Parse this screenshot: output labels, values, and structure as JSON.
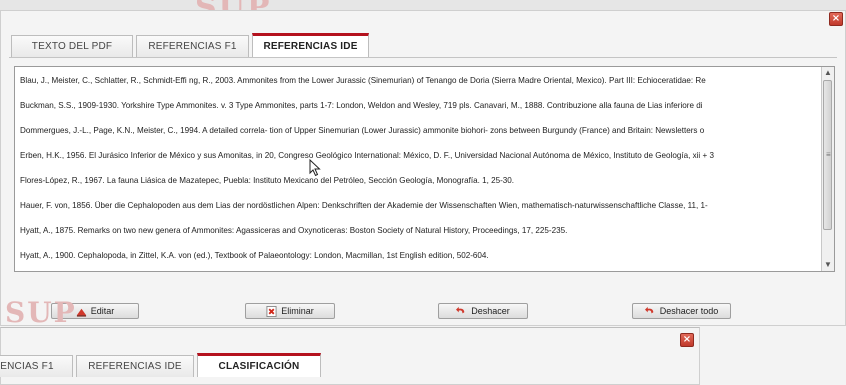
{
  "colors": {
    "accent": "#b4111d",
    "close": "#c0392b"
  },
  "background": {
    "logo_text": "SUP"
  },
  "window_main": {
    "close_icon": "close-icon",
    "tabs": [
      {
        "label": "TEXTO DEL PDF",
        "active": false
      },
      {
        "label": "REFERENCIAS F1",
        "active": false
      },
      {
        "label": "REFERENCIAS IDE",
        "active": true
      }
    ],
    "references": [
      "Blau, J., Meister, C., Schlatter, R., Schmidt-Effi ng, R., 2003. Ammonites from the Lower Jurassic (Sinemurian) of Tenango de Doria (Sierra Madre Oriental, Mexico). Part III: Echioceratidae: Re",
      "Buckman, S.S., 1909-1930. Yorkshire Type Ammonites. v. 3 Type Ammonites, parts 1-7: London, Weldon and Wesley, 719 pls. Canavari, M., 1888. Contribuzione alla fauna de Lias inferiore di",
      "Dommergues, J.-L., Page, K.N., Meister, C., 1994. A detailed correla- tion of Upper Sinemurian (Lower Jurassic) ammonite biohori- zons between Burgundy (France) and Britain: Newsletters o",
      "Erben, H.K., 1956. El Jurásico Inferior de México y sus Amonitas, in 20, Congreso Geológico International: México, D. F., Universidad Nacional Autónoma de México, Instituto de Geología, xii + 3",
      "Flores-López, R., 1967. La fauna Liásica de Mazatepec, Puebla: Instituto Mexicano del Petróleo, Sección Geología, Monografía. 1, 25-30.",
      "Hauer, F. von, 1856. Über die Cephalopoden aus dem Lias der nordöstlichen Alpen: Denkschriften der Akademie der Wissenschaften Wien, mathematisch-naturwissenschaftliche Classe, 11, 1-",
      "Hyatt, A., 1875. Remarks on two new genera of Ammonites: Agassiceras and Oxynoticeras: Boston Society of Natural History, Proceedings, 17, 225-235.",
      "Hyatt, A., 1900. Cephalopoda, in Zittel, K.A. von (ed.), Textbook of Palaeontology: London, Macmillan, 1st English edition, 502-604."
    ],
    "buttons": [
      {
        "label": "Editar",
        "icon": "edit-icon"
      },
      {
        "label": "Eliminar",
        "icon": "delete-icon"
      },
      {
        "label": "Deshacer",
        "icon": "undo-icon"
      },
      {
        "label": "Deshacer todo",
        "icon": "undo-all-icon"
      }
    ]
  },
  "window_secondary": {
    "close_icon": "close-icon",
    "tabs": [
      {
        "label": "ENCIAS F1",
        "active": false
      },
      {
        "label": "REFERENCIAS IDE",
        "active": false
      },
      {
        "label": "CLASIFICACIÓN",
        "active": true
      }
    ]
  }
}
